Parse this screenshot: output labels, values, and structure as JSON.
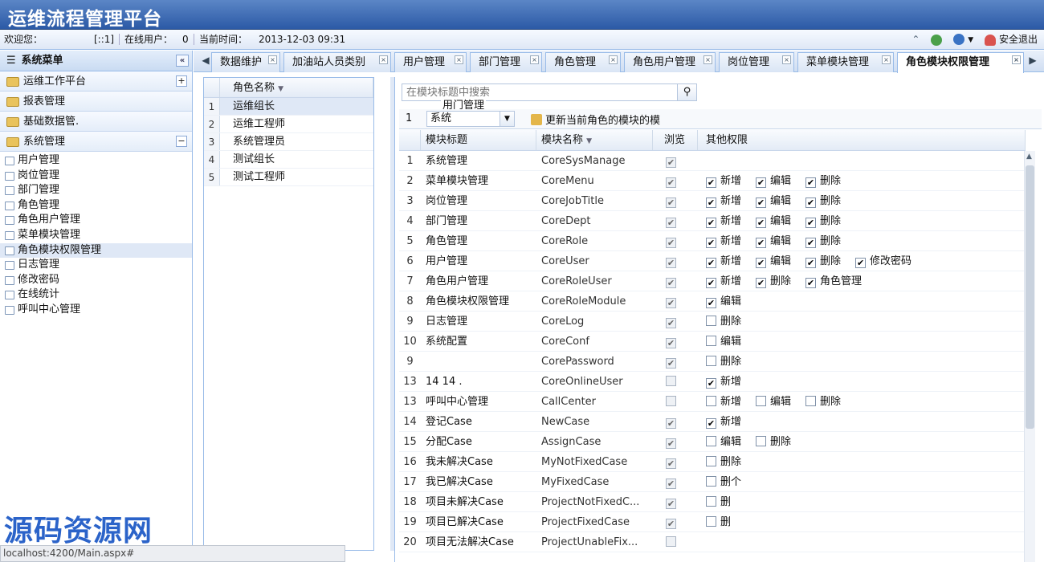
{
  "app": {
    "title": "运维流程管理平台"
  },
  "status": {
    "welcome": "欢迎您：",
    "ip": "[::1]",
    "online_label": "在线用户：",
    "online_count": "0",
    "time_label": "当前时间：",
    "time": "2013-12-03 09:31",
    "logout": "安全退出"
  },
  "sidebar": {
    "title": "系统菜单",
    "groups": [
      {
        "label": "运维工作平台",
        "toggle": "+"
      },
      {
        "label": "报表管理"
      },
      {
        "label": "基础数据管."
      },
      {
        "label": "系统管理",
        "toggle": "−"
      }
    ],
    "items": [
      "用户管理",
      "岗位管理",
      "部门管理",
      "角色管理",
      "角色用户管理",
      "菜单模块管理",
      "角色模块权限管理",
      "日志管理",
      "修改密码",
      "在线统计",
      "呼叫中心管理"
    ]
  },
  "tabs": [
    "数据维护",
    "加油站人员类别",
    "用户管理",
    "部门管理",
    "角色管理",
    "角色用户管理",
    "岗位管理",
    "菜单模块管理",
    "角色模块权限管理"
  ],
  "roles": {
    "header": "角色名称",
    "rows": [
      "运维组长",
      "运维工程师",
      "系统管理员",
      "测试组长",
      "测试工程师"
    ]
  },
  "main": {
    "search_placeholder": "在模块标题中搜索",
    "floating_label": "用门管理",
    "toolbar_num": "1",
    "system_select": "系统",
    "update_button": "更新当前角色的模块的模",
    "columns": [
      "模块标题",
      "模块名称",
      "浏览",
      "其他权限"
    ],
    "rows": [
      {
        "n": "1",
        "title": "系统管理",
        "name": "CoreSysManage",
        "browse": true,
        "perms": []
      },
      {
        "n": "2",
        "title": "菜单模块管理",
        "name": "CoreMenu",
        "browse": true,
        "perms": [
          {
            "l": "新增",
            "c": true
          },
          {
            "l": "编辑",
            "c": true
          },
          {
            "l": "删除",
            "c": true
          }
        ]
      },
      {
        "n": "3",
        "title": "岗位管理",
        "name": "CoreJobTitle",
        "browse": true,
        "perms": [
          {
            "l": "新增",
            "c": true
          },
          {
            "l": "编辑",
            "c": true
          },
          {
            "l": "删除",
            "c": true
          }
        ]
      },
      {
        "n": "4",
        "title": "部门管理",
        "name": "CoreDept",
        "browse": true,
        "perms": [
          {
            "l": "新增",
            "c": true
          },
          {
            "l": "编辑",
            "c": true
          },
          {
            "l": "删除",
            "c": true
          }
        ]
      },
      {
        "n": "5",
        "title": "角色管理",
        "name": "CoreRole",
        "browse": true,
        "perms": [
          {
            "l": "新增",
            "c": true
          },
          {
            "l": "编辑",
            "c": true
          },
          {
            "l": "删除",
            "c": true
          }
        ]
      },
      {
        "n": "6",
        "title": "用户管理",
        "name": "CoreUser",
        "browse": true,
        "perms": [
          {
            "l": "新增",
            "c": true
          },
          {
            "l": "编辑",
            "c": true
          },
          {
            "l": "删除",
            "c": true
          },
          {
            "l": "修改密码",
            "c": true
          }
        ]
      },
      {
        "n": "7",
        "title": "角色用户管理",
        "name": "CoreRoleUser",
        "browse": true,
        "perms": [
          {
            "l": "新增",
            "c": true
          },
          {
            "l": "删除",
            "c": true
          },
          {
            "l": "角色管理",
            "c": true
          }
        ]
      },
      {
        "n": "8",
        "title": "角色模块权限管理",
        "name": "CoreRoleModule",
        "browse": true,
        "perms": [
          {
            "l": "编辑",
            "c": true
          }
        ]
      },
      {
        "n": "9",
        "title": "日志管理",
        "name": "CoreLog",
        "browse": true,
        "perms": [
          {
            "l": "删除",
            "c": false
          }
        ]
      },
      {
        "n": "10",
        "title": "系统配置",
        "name": "CoreConf",
        "browse": true,
        "perms": [
          {
            "l": "编辑",
            "c": false
          }
        ]
      },
      {
        "n": "9",
        "title": "",
        "name": "CorePassword",
        "browse": true,
        "perms": [
          {
            "l": "删除",
            "c": false
          }
        ]
      },
      {
        "n": "13",
        "title": "14   14 .",
        "name": "CoreOnlineUser",
        "browse": false,
        "perms": [
          {
            "l": "新增",
            "c": true
          }
        ]
      },
      {
        "n": "13",
        "title": "呼叫中心管理",
        "name": "CallCenter",
        "browse": false,
        "perms": [
          {
            "l": "新增",
            "c": false
          },
          {
            "l": "编辑",
            "c": false
          },
          {
            "l": "删除",
            "c": false
          }
        ]
      },
      {
        "n": "14",
        "title": "登记Case",
        "name": "NewCase",
        "browse": true,
        "perms": [
          {
            "l": "新增",
            "c": true
          }
        ]
      },
      {
        "n": "15",
        "title": "分配Case",
        "name": "AssignCase",
        "browse": true,
        "perms": [
          {
            "l": "编辑",
            "c": false
          },
          {
            "l": "删除",
            "c": false
          }
        ]
      },
      {
        "n": "16",
        "title": "我未解决Case",
        "name": "MyNotFixedCase",
        "browse": true,
        "perms": [
          {
            "l": "删除",
            "c": false
          }
        ]
      },
      {
        "n": "17",
        "title": "我已解决Case",
        "name": "MyFixedCase",
        "browse": true,
        "perms": [
          {
            "l": "删个",
            "c": false
          }
        ]
      },
      {
        "n": "18",
        "title": "项目未解决Case",
        "name": "ProjectNotFixedC...",
        "browse": true,
        "perms": [
          {
            "l": "删",
            "c": false
          }
        ]
      },
      {
        "n": "19",
        "title": "项目已解决Case",
        "name": "ProjectFixedCase",
        "browse": true,
        "perms": [
          {
            "l": "删",
            "c": false
          }
        ]
      },
      {
        "n": "20",
        "title": "项目无法解决Case",
        "name": "ProjectUnableFix...",
        "browse": false,
        "perms": []
      }
    ]
  },
  "watermark": "源码资源网",
  "statusurl": "localhost:4200/Main.aspx#",
  "colors": {
    "title_bg": "#2c5aa6",
    "border": "#99bbe8",
    "selected": "#dfe8f6",
    "watermark": "#2b63c9"
  }
}
